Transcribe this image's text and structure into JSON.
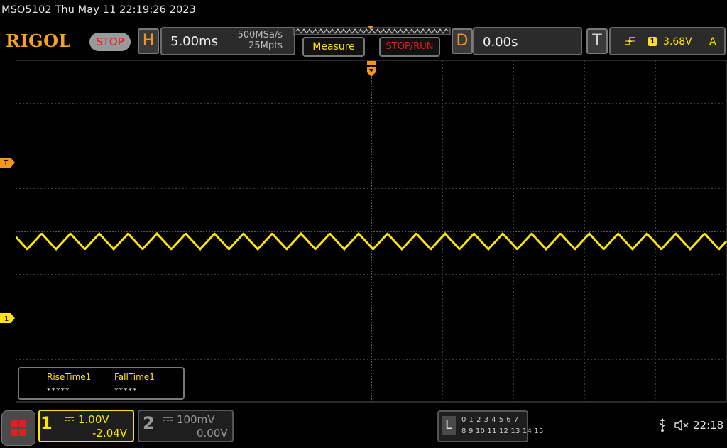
{
  "header": {
    "info_line": "MSO5102  Thu May 11 22:19:26 2023",
    "logo": "RIGOL",
    "run_state": "STOP"
  },
  "horizontal": {
    "label": "H",
    "timebase": "5.00ms",
    "sample_rate": "500MSa/s",
    "memory_depth": "25Mpts"
  },
  "buttons": {
    "measure": "Measure",
    "stop_run": "STOP/RUN"
  },
  "delay": {
    "label": "D",
    "value": "0.00s"
  },
  "trigger": {
    "label": "T",
    "source": "1",
    "level": "3.68V",
    "mode": "A"
  },
  "markers": {
    "trigger_level": "T",
    "ch1_ground": "1"
  },
  "measurements": [
    {
      "label": "RiseTime1",
      "value": "*****"
    },
    {
      "label": "FallTime1",
      "value": "*****"
    }
  ],
  "channels": [
    {
      "number": "1",
      "scale": "1.00V",
      "offset": "-2.04V",
      "color": "#ffe600"
    },
    {
      "number": "2",
      "scale": "100mV",
      "offset": "0.00V",
      "color": "#9a9a9a"
    }
  ],
  "logic": {
    "label": "L",
    "row1": "0 1 2 3   4 5 6 7",
    "row2": "8 9 10 11 12 13 14 15"
  },
  "status": {
    "clock": "22:18"
  },
  "colors": {
    "accent_orange": "#f7931e",
    "ch1_yellow": "#ffe600",
    "stop_red": "#e81b1b"
  }
}
